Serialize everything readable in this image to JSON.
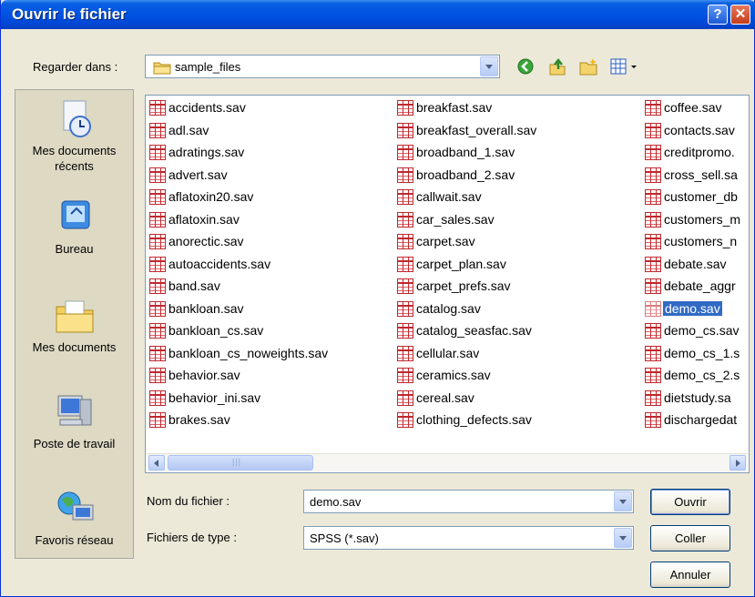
{
  "window": {
    "title": "Ouvrir le fichier"
  },
  "lookin": {
    "label": "Regarder dans :",
    "value": "sample_files"
  },
  "places": [
    {
      "name": "recent",
      "label": "Mes documents récents"
    },
    {
      "name": "desktop",
      "label": "Bureau"
    },
    {
      "name": "documents",
      "label": "Mes documents"
    },
    {
      "name": "computer",
      "label": "Poste de travail"
    },
    {
      "name": "network",
      "label": "Favoris réseau"
    }
  ],
  "files": {
    "col1": [
      "accidents.sav",
      "adl.sav",
      "adratings.sav",
      "advert.sav",
      "aflatoxin20.sav",
      "aflatoxin.sav",
      "anorectic.sav",
      "autoaccidents.sav",
      "band.sav",
      "bankloan.sav",
      "bankloan_cs.sav",
      "bankloan_cs_noweights.sav",
      "behavior.sav",
      "behavior_ini.sav",
      "brakes.sav"
    ],
    "col2": [
      "breakfast.sav",
      "breakfast_overall.sav",
      "broadband_1.sav",
      "broadband_2.sav",
      "callwait.sav",
      "car_sales.sav",
      "carpet.sav",
      "carpet_plan.sav",
      "carpet_prefs.sav",
      "catalog.sav",
      "catalog_seasfac.sav",
      "cellular.sav",
      "ceramics.sav",
      "cereal.sav",
      "clothing_defects.sav"
    ],
    "col3": [
      "coffee.sav",
      "contacts.sav",
      "creditpromo.",
      "cross_sell.sa",
      "customer_db",
      "customers_m",
      "customers_n",
      "debate.sav",
      "debate_aggr",
      "demo.sav",
      "demo_cs.sav",
      "demo_cs_1.s",
      "demo_cs_2.s",
      "dietstudy.sa",
      "dischargedat"
    ],
    "selected": "demo.sav"
  },
  "filename": {
    "label": "Nom du fichier :",
    "value": "demo.sav"
  },
  "filetype": {
    "label": "Fichiers de type :",
    "value": "SPSS (*.sav)"
  },
  "buttons": {
    "open": "Ouvrir",
    "paste": "Coller",
    "cancel": "Annuler"
  }
}
